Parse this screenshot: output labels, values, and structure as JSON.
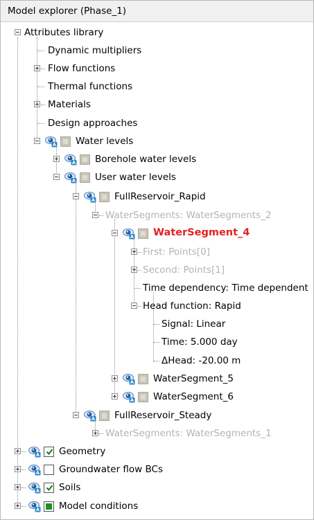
{
  "title": "Model explorer (Phase_1)",
  "tree": {
    "attributes_library": "Attributes library",
    "dynamic_multipliers": "Dynamic multipliers",
    "flow_functions": "Flow functions",
    "thermal_functions": "Thermal functions",
    "materials": "Materials",
    "design_approaches": "Design approaches",
    "water_levels": "Water levels",
    "borehole_water_levels": "Borehole water levels",
    "user_water_levels": "User water levels",
    "full_reservoir_rapid": "FullReservoir_Rapid",
    "water_segments_2": "WaterSegments: WaterSegments_2",
    "water_segment_4": "WaterSegment_4",
    "first_points": "First: Points[0]",
    "second_points": "Second: Points[1]",
    "time_dependency": "Time dependency: Time dependent",
    "head_function": "Head function: Rapid",
    "signal": "Signal: Linear",
    "time": "Time: 5.000 day",
    "delta_head": "ΔHead: -20.00 m",
    "water_segment_5": "WaterSegment_5",
    "water_segment_6": "WaterSegment_6",
    "full_reservoir_steady": "FullReservoir_Steady",
    "water_segments_1": "WaterSegments: WaterSegments_1",
    "geometry": "Geometry",
    "groundwater_flow_bcs": "Groundwater flow BCs",
    "soils": "Soils",
    "model_conditions": "Model conditions"
  },
  "checkbox_states": {
    "geometry": "checked",
    "groundwater_flow_bcs": "unchecked",
    "soils": "checked",
    "model_conditions": "partial"
  },
  "colors": {
    "selected_label": "#e32222",
    "dim_label": "#b3b3b3",
    "check_green": "#1f8f1f",
    "eye_blue": "#1a5fa8"
  },
  "icons": [
    "collapse-icon",
    "expand-icon",
    "eye-icon",
    "visibility-checkbox"
  ]
}
